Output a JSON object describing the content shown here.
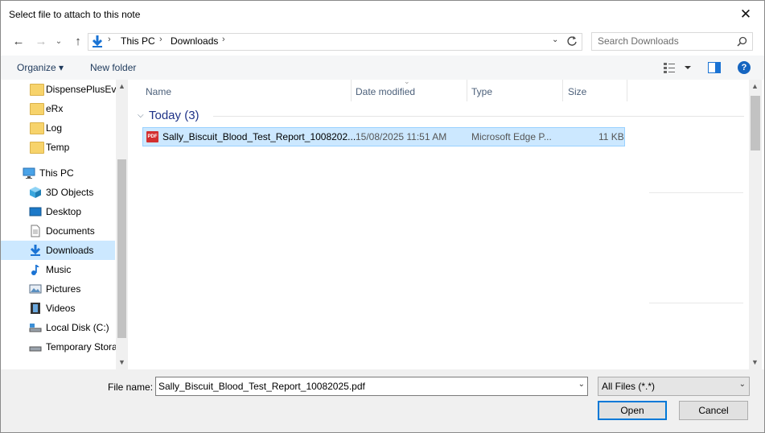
{
  "window": {
    "title": "Select file to attach to this note",
    "close_glyph": "✕"
  },
  "nav": {
    "back_glyph": "←",
    "forward_glyph": "→",
    "up_glyph": "↑",
    "breadcrumb": [
      "This PC",
      "Downloads"
    ],
    "search_placeholder": "Search Downloads"
  },
  "toolbar": {
    "organize": "Organize ▾",
    "new_folder": "New folder",
    "help": "?"
  },
  "sidebar": {
    "items": [
      {
        "label": "DispensePlusEve",
        "icon": "folder-icon"
      },
      {
        "label": "eRx",
        "icon": "folder-icon"
      },
      {
        "label": "Log",
        "icon": "folder-icon"
      },
      {
        "label": "Temp",
        "icon": "folder-icon"
      },
      {
        "label": "This PC",
        "icon": "computer-icon"
      },
      {
        "label": "3D Objects",
        "icon": "cube-icon"
      },
      {
        "label": "Desktop",
        "icon": "desktop-icon"
      },
      {
        "label": "Documents",
        "icon": "document-icon"
      },
      {
        "label": "Downloads",
        "icon": "download-icon",
        "selected": true
      },
      {
        "label": "Music",
        "icon": "music-icon"
      },
      {
        "label": "Pictures",
        "icon": "pictures-icon"
      },
      {
        "label": "Videos",
        "icon": "video-icon"
      },
      {
        "label": "Local Disk (C:)",
        "icon": "drive-icon"
      },
      {
        "label": "Temporary Stora",
        "icon": "drive-icon"
      }
    ]
  },
  "columns": {
    "name": "Name",
    "date": "Date modified",
    "type": "Type",
    "size": "Size"
  },
  "group": {
    "label": "Today (3)"
  },
  "files": [
    {
      "name": "Sally_Biscuit_Blood_Test_Report_1008202...",
      "date": "15/08/2025 11:51 AM",
      "type": "Microsoft Edge P...",
      "size": "11 KB",
      "icon_text": "PDF"
    }
  ],
  "footer": {
    "file_name_label": "File name:",
    "file_name_value": "Sally_Biscuit_Blood_Test_Report_10082025.pdf",
    "filter_value": "All Files (*.*)",
    "open": "Open",
    "cancel": "Cancel"
  }
}
